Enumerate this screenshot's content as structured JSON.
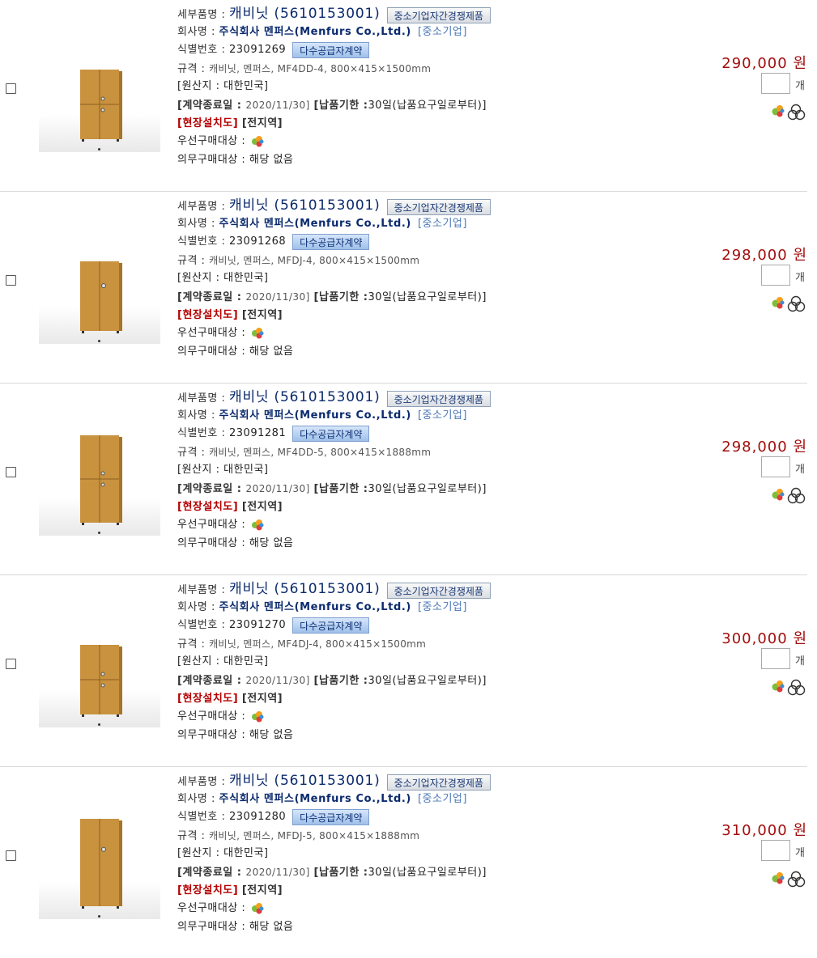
{
  "labels": {
    "detail_name": "세부품명 : ",
    "company": "회사명 : ",
    "id": "식별번호 : ",
    "spec": "규격 : ",
    "origin": "[원산지 : 대한민국]",
    "contract_end": "[계약종료일 : ",
    "delivery": "[납품기한 :",
    "onsite": "[현장설치도]",
    "region": "[전지역]",
    "priority": "우선구매대상 : ",
    "mandatory": "의무구매대상 : ",
    "badge_sme_compete": "중소기업자간경쟁제품",
    "badge_multi_supplier": "다수공급자계약",
    "unit": "개"
  },
  "colors": {
    "price": "#a30e0e",
    "accent": "#0b2a6e",
    "red_label": "#b40000",
    "sme_link": "#4a78b8"
  },
  "products": [
    {
      "name": "캐비닛 (5610153001)",
      "company": "주식회사 멘퍼스(Menfurs Co.,Ltd.)",
      "company_tag": "[중소기업]",
      "id": "23091269",
      "spec": "캐비닛, 멘퍼스, MF4DD-4, 800×415×1500mm",
      "contract_end": "2020/11/30]",
      "delivery": "30일(납품요구일로부터)]",
      "mandatory_value": "해당 없음",
      "price": "290,000 원",
      "cabinet": {
        "kind": "4door-lock",
        "height": 0.62
      }
    },
    {
      "name": "캐비닛 (5610153001)",
      "company": "주식회사 멘퍼스(Menfurs Co.,Ltd.)",
      "company_tag": "[중소기업]",
      "id": "23091268",
      "spec": "캐비닛, 멘퍼스, MFDJ-4, 800×415×1500mm",
      "contract_end": "2020/11/30]",
      "delivery": "30일(납품요구일로부터)]",
      "mandatory_value": "해당 없음",
      "price": "298,000 원",
      "cabinet": {
        "kind": "2door-lock",
        "height": 0.62
      }
    },
    {
      "name": "캐비닛 (5610153001)",
      "company": "주식회사 멘퍼스(Menfurs Co.,Ltd.)",
      "company_tag": "[중소기업]",
      "id": "23091281",
      "spec": "캐비닛, 멘퍼스, MF4DD-5, 800×415×1888mm",
      "contract_end": "2020/11/30]",
      "delivery": "30일(납품요구일로부터)]",
      "mandatory_value": "해당 없음",
      "price": "298,000 원",
      "cabinet": {
        "kind": "4door-lock",
        "height": 0.78
      }
    },
    {
      "name": "캐비닛 (5610153001)",
      "company": "주식회사 멘퍼스(Menfurs Co.,Ltd.)",
      "company_tag": "[중소기업]",
      "id": "23091270",
      "spec": "캐비닛, 멘퍼스, MF4DJ-4, 800×415×1500mm",
      "contract_end": "2020/11/30]",
      "delivery": "30일(납품요구일로부터)]",
      "mandatory_value": "해당 없음",
      "price": "300,000 원",
      "cabinet": {
        "kind": "4door-lock",
        "height": 0.62
      }
    },
    {
      "name": "캐비닛 (5610153001)",
      "company": "주식회사 멘퍼스(Menfurs Co.,Ltd.)",
      "company_tag": "[중소기업]",
      "id": "23091280",
      "spec": "캐비닛, 멘퍼스, MFDJ-5, 800×415×1888mm",
      "contract_end": "2020/11/30]",
      "delivery": "30일(납품요구일로부터)]",
      "mandatory_value": "해당 없음",
      "price": "310,000 원",
      "cabinet": {
        "kind": "2door-lock",
        "height": 0.78
      }
    }
  ]
}
